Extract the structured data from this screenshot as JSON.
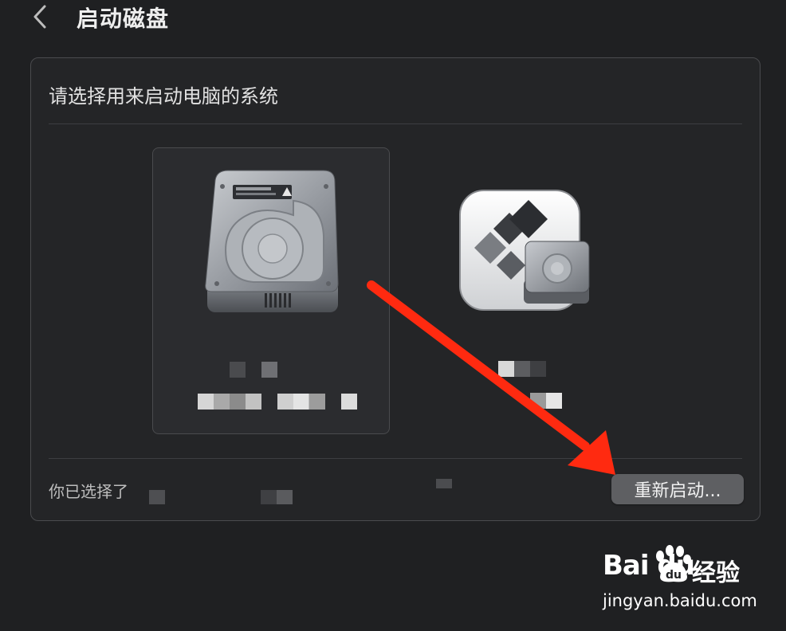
{
  "header": {
    "title": "启动磁盘",
    "back_icon": "chevron-left-icon"
  },
  "panel": {
    "prompt": "请选择用来启动电脑的系统",
    "disks": [
      {
        "icon": "internal-hard-drive-icon",
        "selected": true
      },
      {
        "icon": "bootcamp-windows-drive-icon",
        "selected": false
      }
    ],
    "selected_prefix": "你已选择了",
    "restart_label": "重新启动..."
  },
  "annotation": {
    "color": "#ff2a10"
  },
  "watermark": {
    "logo": "Bai du",
    "brand": "经验",
    "site": "jingyan.baidu.com"
  }
}
